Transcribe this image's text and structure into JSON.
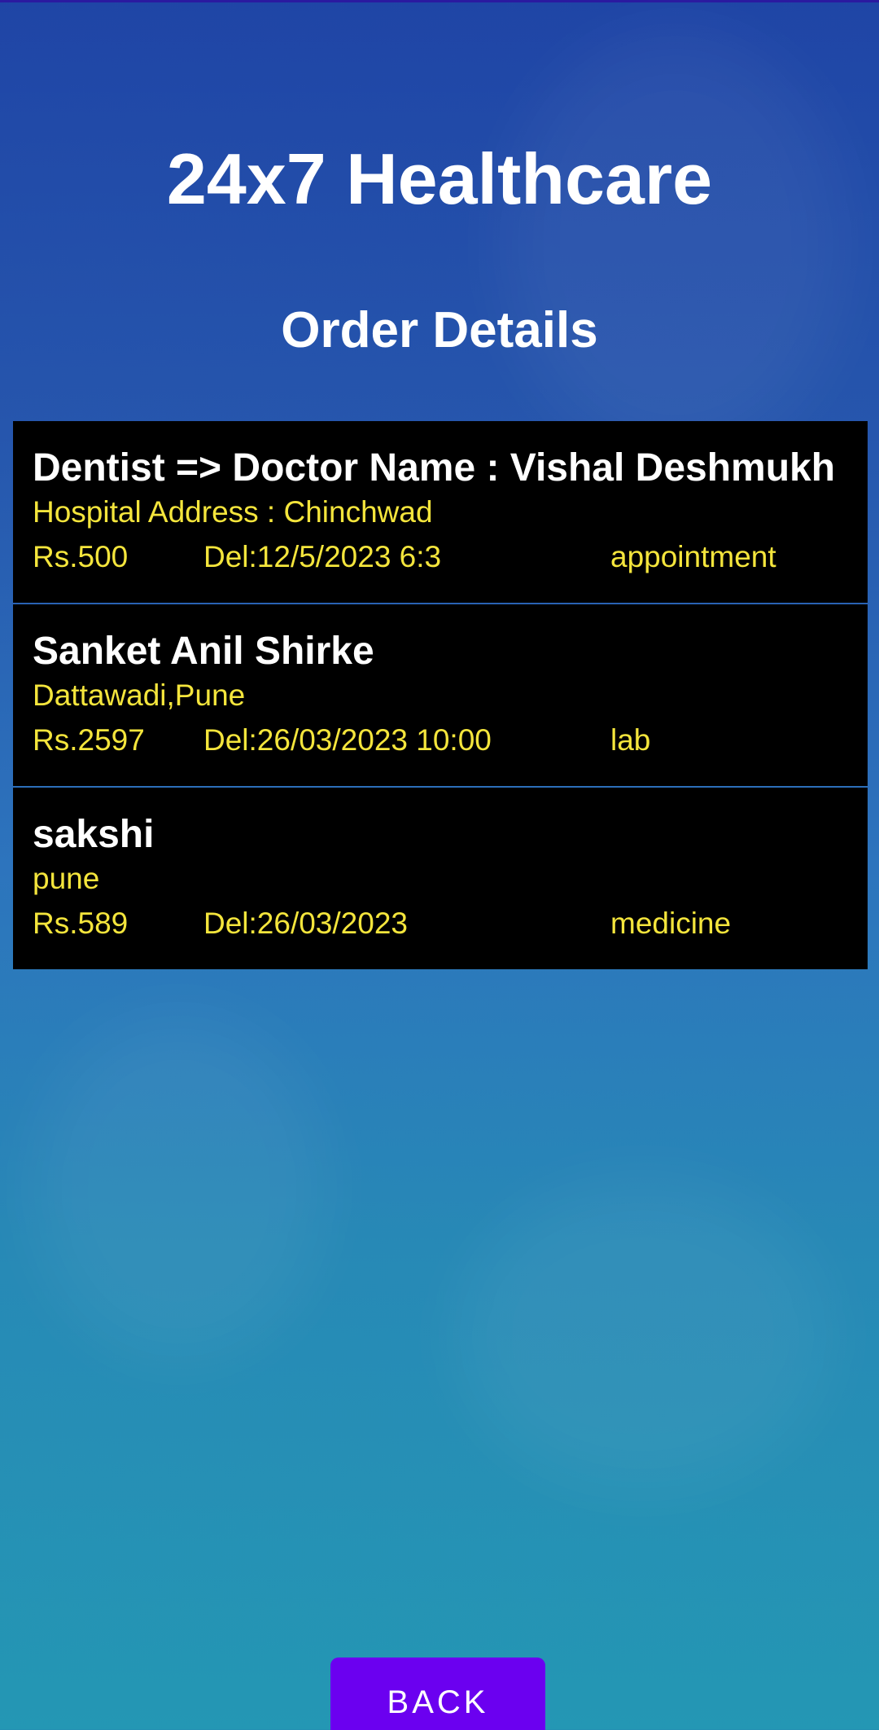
{
  "header": {
    "app_title": "24x7 Healthcare",
    "page_title": "Order Details"
  },
  "orders": [
    {
      "name": "Dentist => Doctor Name : Vishal Deshmukh",
      "address": "Hospital Address : Chinchwad",
      "price": "Rs.500",
      "date": "Del:12/5/2023 6:3",
      "type": "appointment"
    },
    {
      "name": "Sanket Anil Shirke",
      "address": "Dattawadi,Pune",
      "price": "Rs.2597",
      "date": "Del:26/03/2023 10:00",
      "type": "lab"
    },
    {
      "name": "sakshi",
      "address": "pune",
      "price": "Rs.589",
      "date": "Del:26/03/2023",
      "type": "medicine"
    }
  ],
  "footer": {
    "back_label": "BACK"
  },
  "colors": {
    "background_top": "#1f45a6",
    "background_bottom": "#2497b4",
    "card_background": "#000000",
    "name_text": "#ffffff",
    "detail_text": "#f4e53c",
    "button": "#6b00f0"
  }
}
